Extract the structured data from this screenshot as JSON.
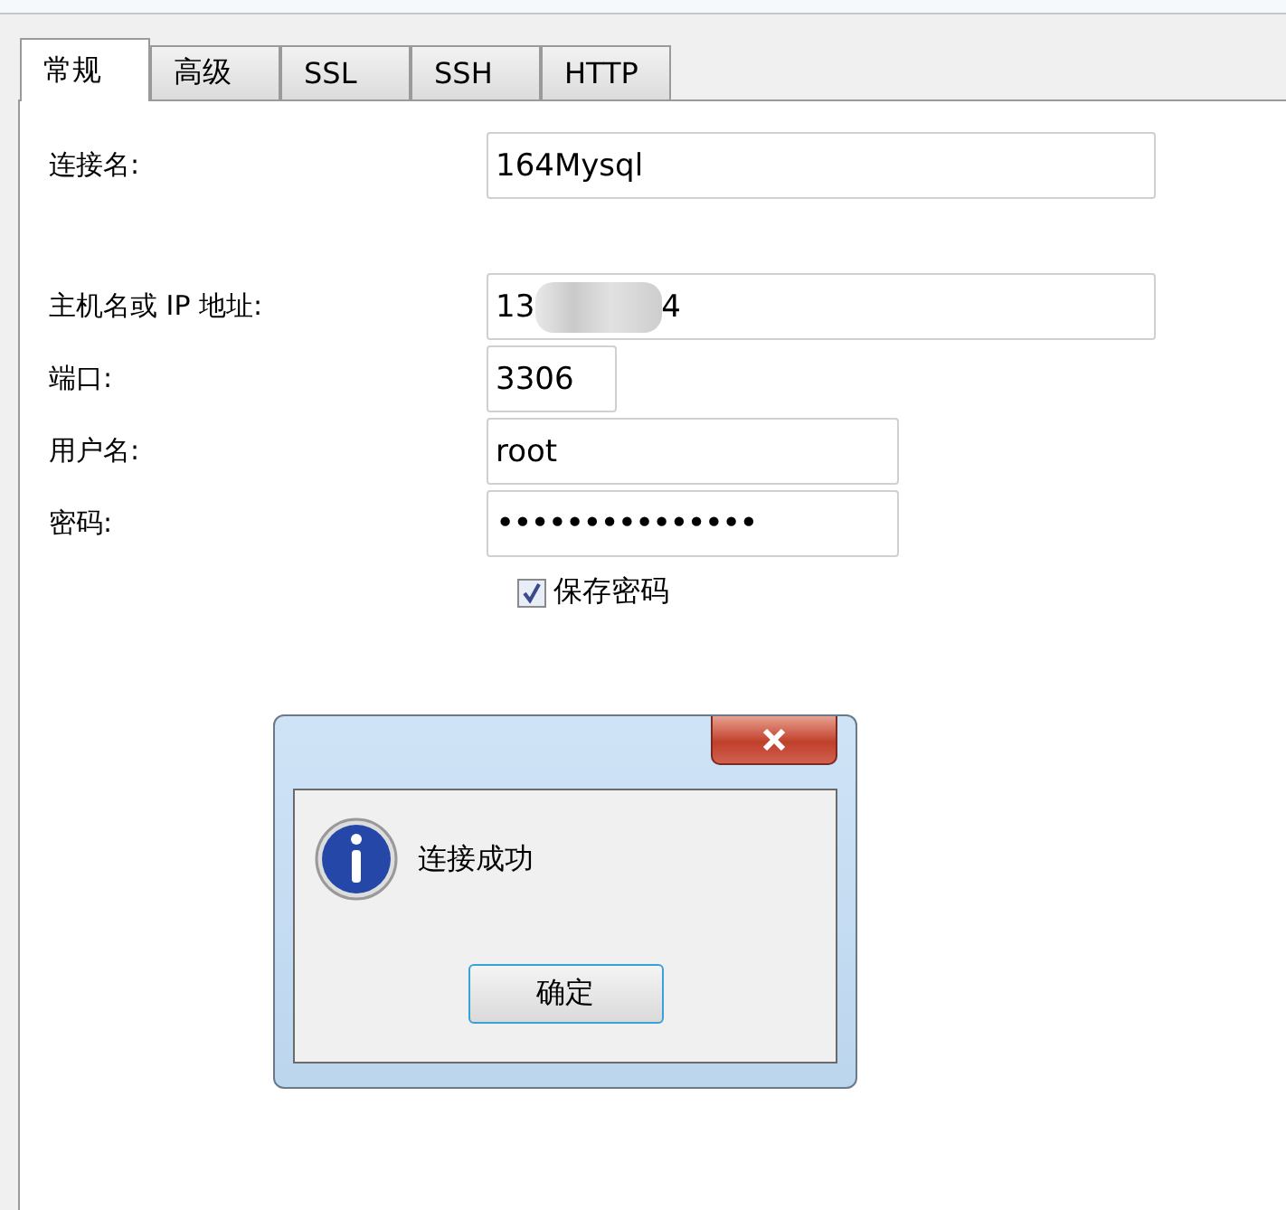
{
  "tabs": [
    {
      "label": "常规",
      "selected": true
    },
    {
      "label": "高级",
      "selected": false
    },
    {
      "label": "SSL",
      "selected": false
    },
    {
      "label": "SSH",
      "selected": false
    },
    {
      "label": "HTTP",
      "selected": false
    }
  ],
  "fields": [
    {
      "kind": "text",
      "label": "连接名:",
      "value": "164Mysql"
    },
    {
      "kind": "redacted",
      "label": "主机名或 IP 地址:",
      "value_parts": [
        "13",
        "4"
      ]
    },
    {
      "kind": "text",
      "label": "端口:",
      "value": "3306"
    },
    {
      "kind": "text",
      "label": "用户名:",
      "value": "root"
    },
    {
      "kind": "password",
      "label": "密码:",
      "value": "•••••••••••••••"
    }
  ],
  "save_password": {
    "label": "保存密码",
    "checked": true
  },
  "dialog": {
    "message": "连接成功",
    "button": "确定"
  }
}
